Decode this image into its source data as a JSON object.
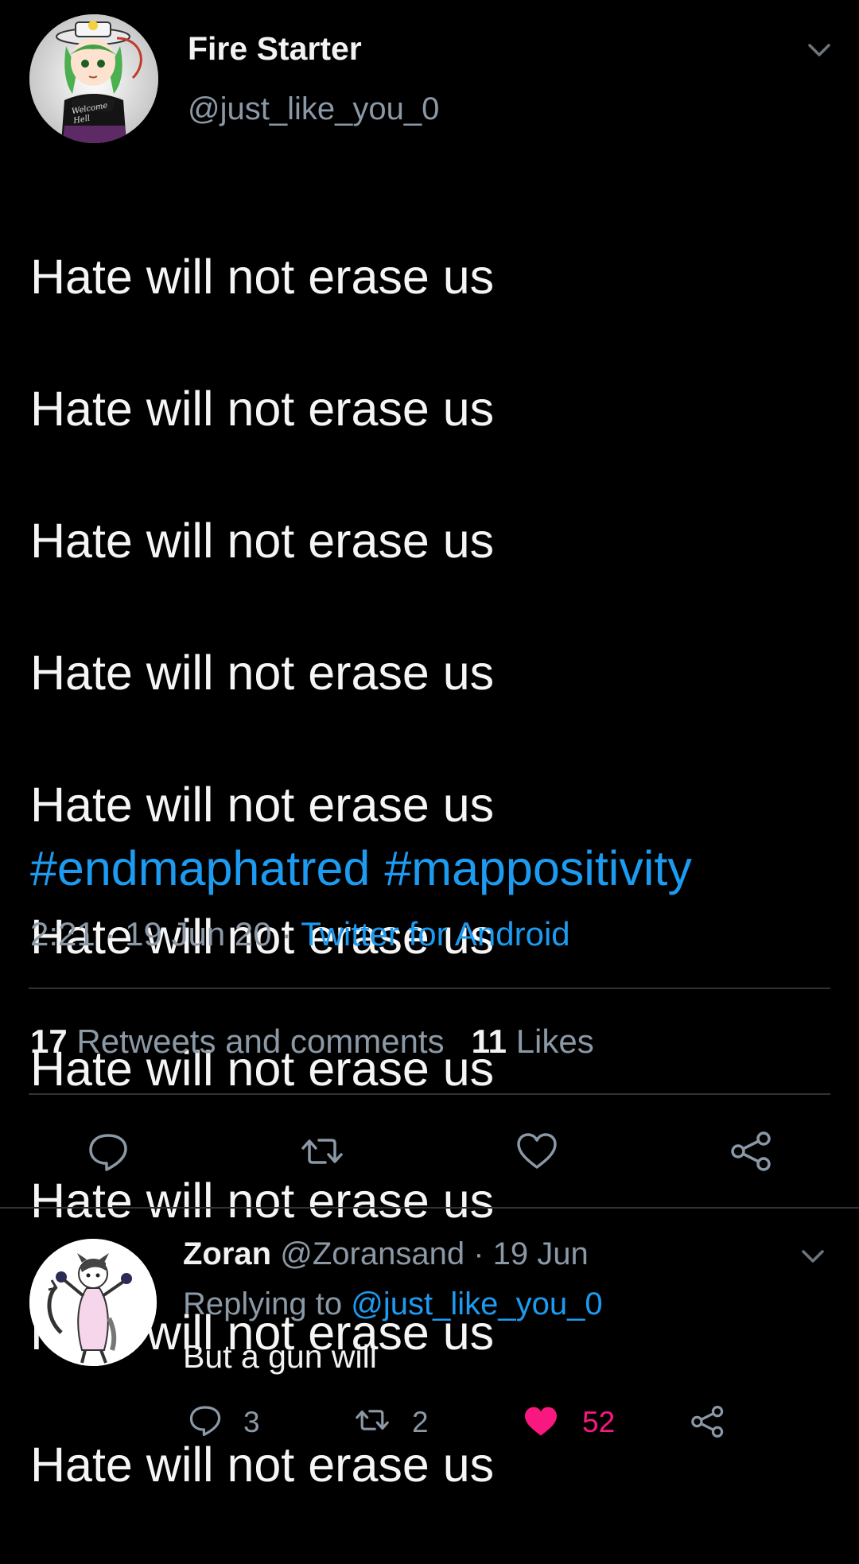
{
  "main_tweet": {
    "author": {
      "name": "Fire Starter",
      "handle": "@just_like_you_0",
      "avatar_icon": "anime-avatar-icon",
      "avatar_shirt_text": "Welcome Hell"
    },
    "body_lines": [
      "Hate will not erase us",
      "Hate will not erase us",
      "Hate will not erase us",
      "Hate will not erase us",
      "Hate will not erase us",
      "Hate will not erase us",
      "Hate will not erase us",
      "Hate will not erase us",
      "Hate will not erase us",
      "Hate will not erase us"
    ],
    "hashtags": [
      "#endmaphatred",
      "#mappositivity"
    ],
    "time": "2:21",
    "date": "19 Jun 20",
    "separator": "·",
    "source": "Twitter for Android",
    "stats": {
      "retweets_count": "17",
      "retweets_label": "Retweets and comments",
      "likes_count": "11",
      "likes_label": "Likes"
    },
    "actions": [
      "reply-icon",
      "retweet-icon",
      "like-icon",
      "share-icon"
    ]
  },
  "reply_tweet": {
    "author_name": "Zoran",
    "author_handle": "@Zoransand",
    "date": "19 Jun",
    "separator": "·",
    "replying_prefix": "Replying to",
    "replying_to": "@just_like_you_0",
    "text": "But a gun will",
    "avatar_icon": "furry-avatar-icon",
    "counts": {
      "replies": "3",
      "retweets": "2",
      "likes": "52"
    },
    "liked": true
  },
  "colors": {
    "background": "#000000",
    "text": "#f2f2f2",
    "muted": "#8b98a5",
    "accent": "#1d9bf0",
    "like": "#f91880",
    "divider": "#2f3336"
  }
}
